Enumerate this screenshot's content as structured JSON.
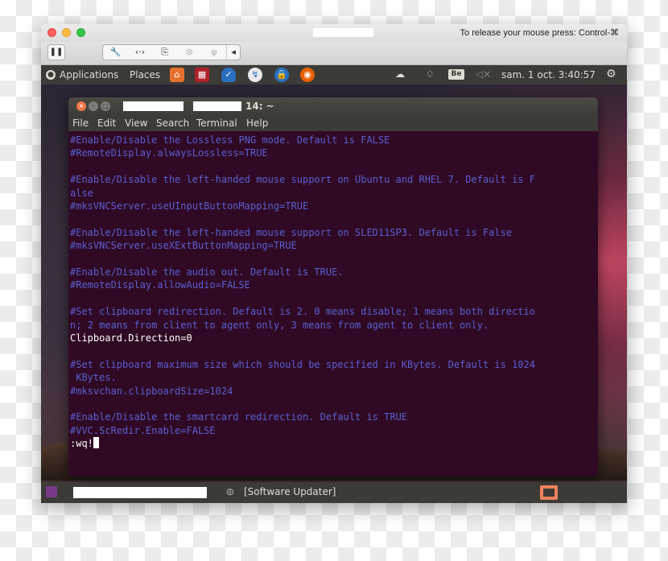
{
  "mac": {
    "release_hint": "To release your mouse press: Control-⌘"
  },
  "vm_toolbar": {
    "pause_glyph": "❚❚",
    "tools": [
      {
        "name": "settings-wrench-icon",
        "glyph": "🔧"
      },
      {
        "name": "shared-folders-icon",
        "glyph": "‹·›"
      },
      {
        "name": "snapshot-icon",
        "glyph": "⎘"
      },
      {
        "name": "hard-disk-icon",
        "glyph": "⊜"
      },
      {
        "name": "usb-icon",
        "glyph": "ψ"
      }
    ],
    "collapse_glyph": "◂"
  },
  "topbar": {
    "applications": "Applications",
    "places": "Places",
    "clock": "sam. 1 oct. 3:40:57",
    "keyboard_layout": "Be",
    "gear_glyph": "⚙"
  },
  "terminal": {
    "title_suffix": "14: ~",
    "menu": [
      "File",
      "Edit",
      "View",
      "Search",
      "Terminal",
      "Help"
    ],
    "lines": [
      {
        "text": "#Enable/Disable the Lossless PNG mode. Default is FALSE",
        "kind": "comment"
      },
      {
        "text": "#RemoteDisplay.alwaysLossless=TRUE",
        "kind": "comment"
      },
      {
        "text": "",
        "kind": "blank"
      },
      {
        "text": "#Enable/Disable the left-handed mouse support on Ubuntu and RHEL 7. Default is F",
        "kind": "comment"
      },
      {
        "text": "alse",
        "kind": "comment"
      },
      {
        "text": "#mksVNCServer.useUInputButtonMapping=TRUE",
        "kind": "comment"
      },
      {
        "text": "",
        "kind": "blank"
      },
      {
        "text": "#Enable/Disable the left-handed mouse support on SLED11SP3. Default is False",
        "kind": "comment"
      },
      {
        "text": "#mksVNCServer.useXExtButtonMapping=TRUE",
        "kind": "comment"
      },
      {
        "text": "",
        "kind": "blank"
      },
      {
        "text": "#Enable/Disable the audio out. Default is TRUE.",
        "kind": "comment"
      },
      {
        "text": "#RemoteDisplay.allowAudio=FALSE",
        "kind": "comment"
      },
      {
        "text": "",
        "kind": "blank"
      },
      {
        "text": "#Set clipboard redirection. Default is 2. 0 means disable; 1 means both directio",
        "kind": "comment"
      },
      {
        "text": "n; 2 means from client to agent only, 3 means from agent to client only.",
        "kind": "comment"
      },
      {
        "text": "Clipboard.Direction=0",
        "kind": "text"
      },
      {
        "text": "",
        "kind": "blank"
      },
      {
        "text": "#Set clipboard maximum size which should be specified in KBytes. Default is 1024",
        "kind": "comment"
      },
      {
        "text": " KBytes.",
        "kind": "comment"
      },
      {
        "text": "#mksvchan.clipboardSize=1024",
        "kind": "comment"
      },
      {
        "text": "",
        "kind": "blank"
      },
      {
        "text": "#Enable/Disable the smartcard redirection. Default is TRUE",
        "kind": "comment"
      },
      {
        "text": "#VVC.ScRedir.Enable=FALSE",
        "kind": "comment"
      },
      {
        "text": ":wq!",
        "kind": "command"
      }
    ]
  },
  "taskbar": {
    "updater_label": "[Software Updater]"
  },
  "colors": {
    "terminal_bg": "#300a24",
    "comment": "#5a5fd0",
    "panel": "#3c3b37",
    "accent": "#f07746"
  }
}
